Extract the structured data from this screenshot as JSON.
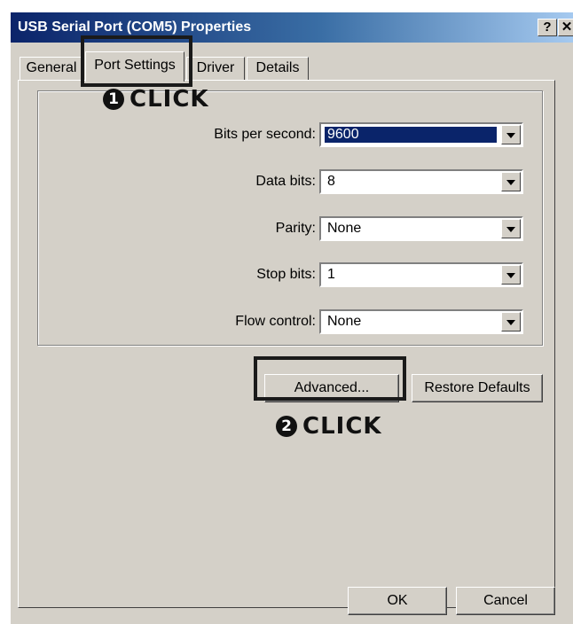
{
  "window": {
    "title": "USB Serial Port (COM5) Properties",
    "help_button": "?",
    "close_button": "✕"
  },
  "tabs": [
    {
      "label": "General",
      "active": false
    },
    {
      "label": "Port Settings",
      "active": true
    },
    {
      "label": "Driver",
      "active": false
    },
    {
      "label": "Details",
      "active": false
    }
  ],
  "settings": {
    "bits_per_second": {
      "label": "Bits per second:",
      "value": "9600"
    },
    "data_bits": {
      "label": "Data bits:",
      "value": "8"
    },
    "parity": {
      "label": "Parity:",
      "value": "None"
    },
    "stop_bits": {
      "label": "Stop bits:",
      "value": "1"
    },
    "flow_control": {
      "label": "Flow control:",
      "value": "None"
    }
  },
  "buttons": {
    "advanced": "Advanced...",
    "restore_defaults": "Restore Defaults",
    "ok": "OK",
    "cancel": "Cancel"
  },
  "callouts": [
    {
      "number": "1",
      "text": "CLICK"
    },
    {
      "number": "2",
      "text": "CLICK"
    }
  ],
  "colors": {
    "title_bar_start": "#0b246a",
    "selection": "#0a246a",
    "face": "#d4d0c8"
  }
}
